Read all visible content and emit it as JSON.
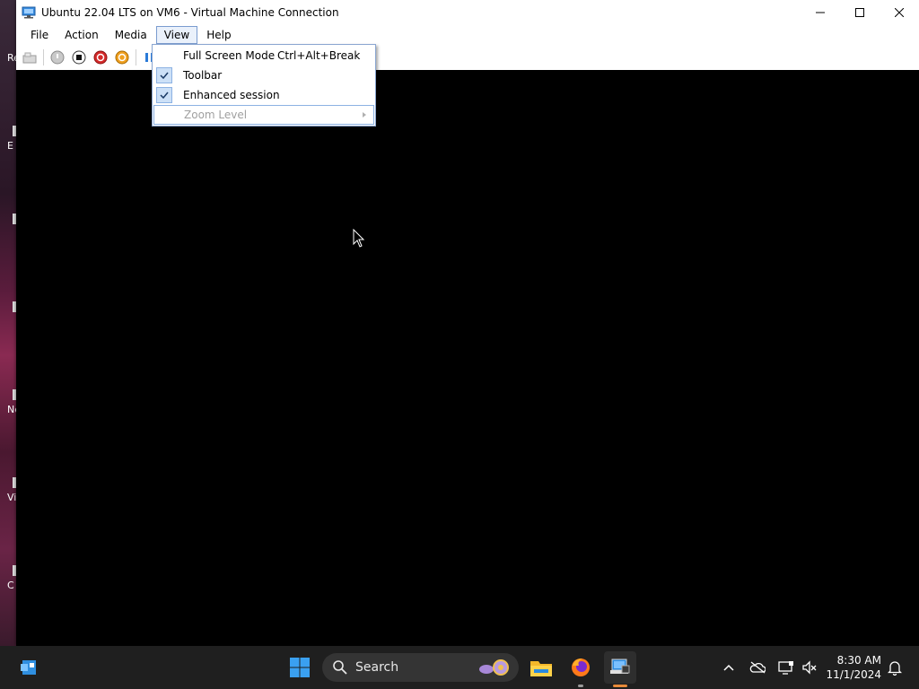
{
  "window": {
    "title": "Ubuntu 22.04 LTS on VM6 - Virtual Machine Connection"
  },
  "menubar": {
    "items": [
      {
        "label": "File"
      },
      {
        "label": "Action"
      },
      {
        "label": "Media"
      },
      {
        "label": "View"
      },
      {
        "label": "Help"
      }
    ]
  },
  "view_menu": {
    "items": [
      {
        "label": "Full Screen Mode",
        "shortcut": "Ctrl+Alt+Break",
        "checked": false
      },
      {
        "label": "Toolbar",
        "checked": true
      },
      {
        "label": "Enhanced session",
        "checked": true
      },
      {
        "label": "Zoom Level",
        "disabled": true,
        "submenu": true
      }
    ]
  },
  "toolbar": {
    "icons": [
      "ctrl-alt-del-icon",
      "start-icon",
      "turn-off-icon",
      "shut-down-icon",
      "save-icon",
      "pause-icon"
    ]
  },
  "desktop": {
    "icon_labels": [
      "Re",
      "E",
      "Ne",
      "Vi",
      "C"
    ]
  },
  "taskbar": {
    "search_label": "Search",
    "time": "8:30 AM",
    "date": "11/1/2024"
  },
  "colors": {
    "menu_highlight": "#eaf1fb",
    "menu_border": "#7a9ccf",
    "taskbar": "#1f1f1f"
  }
}
